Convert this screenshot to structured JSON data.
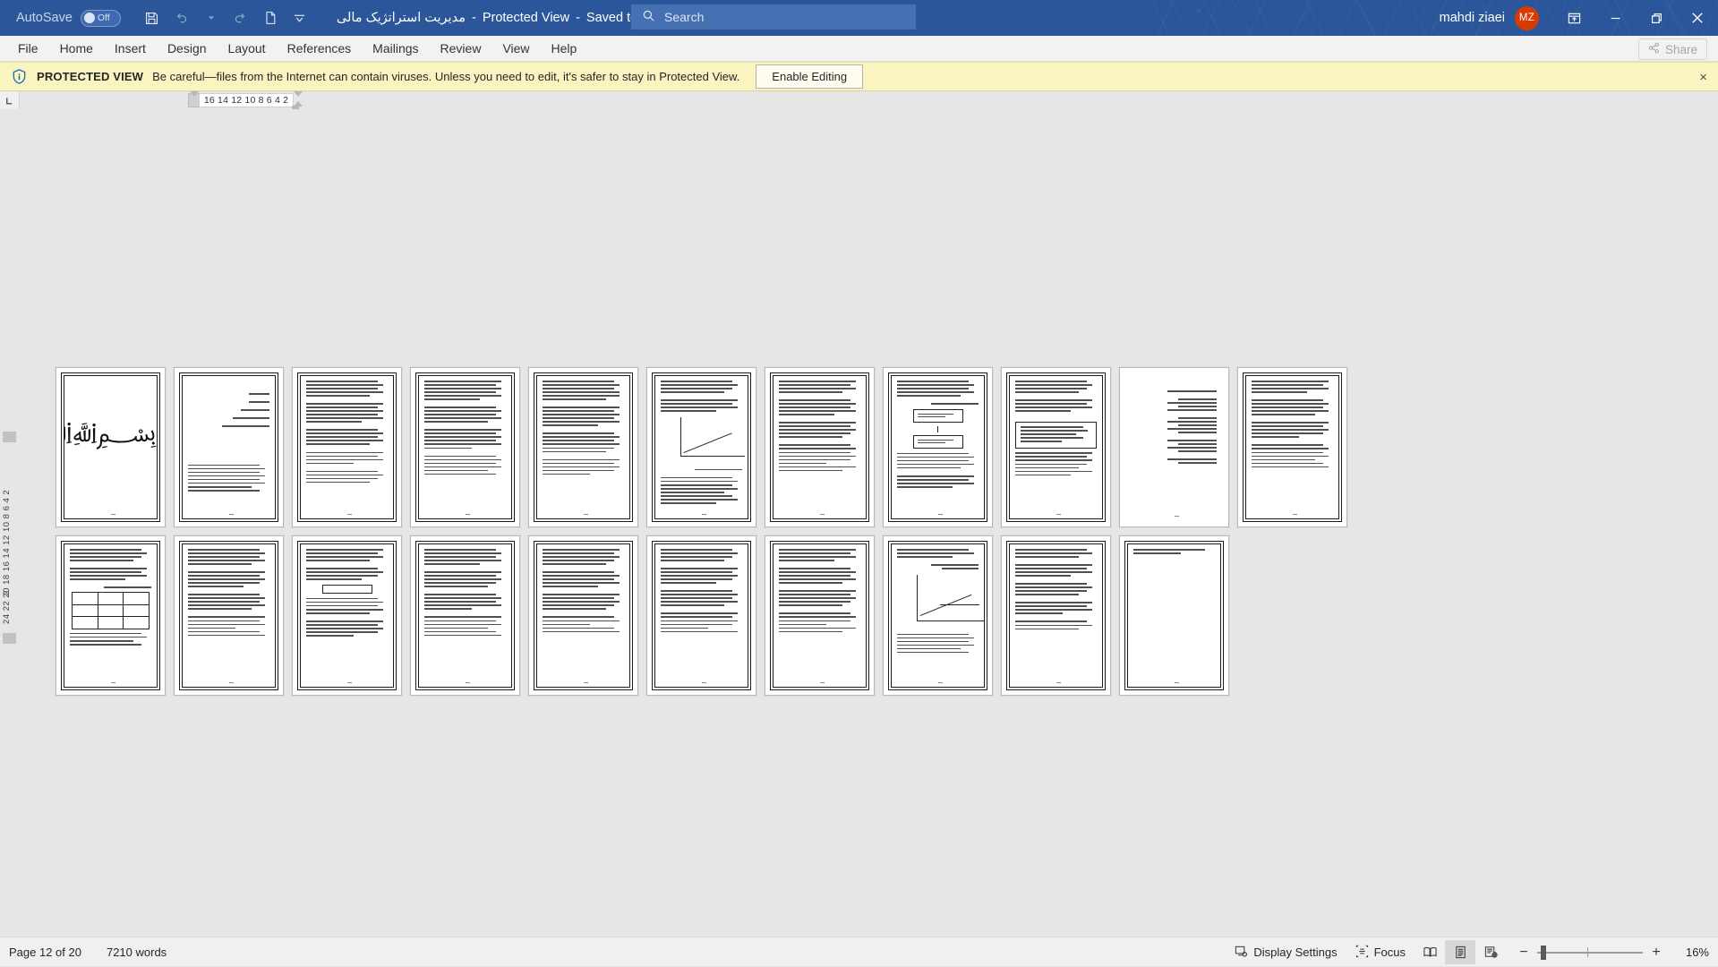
{
  "titlebar": {
    "autosave_label": "AutoSave",
    "autosave_state": "Off",
    "quick_access": [
      {
        "name": "save-icon",
        "label": "Save"
      },
      {
        "name": "undo-icon",
        "label": "Undo"
      },
      {
        "name": "redo-icon",
        "label": "Redo"
      },
      {
        "name": "new-document-icon",
        "label": "New"
      },
      {
        "name": "customize-quick-access-icon",
        "label": "Customize Quick Access Toolbar"
      }
    ],
    "document_name": "مدیریت استراتژیک مالی",
    "separator1": "-",
    "protected_view_label": "Protected View",
    "separator2": "-",
    "save_location": "Saved to this PC",
    "search_placeholder": "Search",
    "search_icon": "search-icon",
    "user_name": "mahdi ziaei",
    "user_initials": "MZ",
    "window_buttons": [
      {
        "name": "ribbon-display-options-icon",
        "label": "Ribbon Display Options"
      },
      {
        "name": "minimize-icon",
        "label": "Minimize"
      },
      {
        "name": "restore-icon",
        "label": "Restore Down"
      },
      {
        "name": "close-icon",
        "label": "Close"
      }
    ],
    "accent_color": "#2b579a",
    "avatar_color": "#d83b01"
  },
  "ribbon": {
    "tabs": [
      {
        "label": "File"
      },
      {
        "label": "Home"
      },
      {
        "label": "Insert"
      },
      {
        "label": "Design"
      },
      {
        "label": "Layout"
      },
      {
        "label": "References"
      },
      {
        "label": "Mailings"
      },
      {
        "label": "Review"
      },
      {
        "label": "View"
      },
      {
        "label": "Help"
      }
    ],
    "share_label": "Share",
    "share_icon": "share-icon"
  },
  "protected_view": {
    "icon": "shield-info-icon",
    "title": "PROTECTED VIEW",
    "message": "Be careful—files from the Internet can contain viruses. Unless you need to edit, it's safer to stay in Protected View.",
    "button_label": "Enable Editing",
    "close_label": "×",
    "background_color": "#faf4c0"
  },
  "rulers": {
    "corner_icon": "tab-stop-left-icon",
    "horizontal_marks": "16 14 12 10  8   6   4   2",
    "vertical_marks": "24 22 20 18 16 14 12 10  8   6   4   2",
    "vertical_top_mark": "2"
  },
  "document": {
    "page_count": 20,
    "zoom_percent": 16,
    "pages": [
      {
        "index": 1,
        "type": "cover-calligraphy",
        "glyph": "﷽"
      },
      {
        "index": 2,
        "type": "title-page"
      },
      {
        "index": 3,
        "type": "text"
      },
      {
        "index": 4,
        "type": "text"
      },
      {
        "index": 5,
        "type": "text"
      },
      {
        "index": 6,
        "type": "text-chart"
      },
      {
        "index": 7,
        "type": "text"
      },
      {
        "index": 8,
        "type": "text-diagram"
      },
      {
        "index": 9,
        "type": "list-page"
      },
      {
        "index": 10,
        "type": "text"
      },
      {
        "index": 11,
        "type": "text-table"
      },
      {
        "index": 12,
        "type": "text"
      },
      {
        "index": 13,
        "type": "text-diagram-small"
      },
      {
        "index": 14,
        "type": "text"
      },
      {
        "index": 15,
        "type": "text"
      },
      {
        "index": 16,
        "type": "text"
      },
      {
        "index": 17,
        "type": "text"
      },
      {
        "index": 18,
        "type": "text-chart"
      },
      {
        "index": 19,
        "type": "text"
      },
      {
        "index": 20,
        "type": "blank"
      }
    ]
  },
  "statusbar": {
    "page_status": "Page 12 of 20",
    "word_count": "7210 words",
    "display_settings_label": "Display Settings",
    "display_settings_icon": "display-settings-icon",
    "focus_label": "Focus",
    "focus_icon": "focus-icon",
    "view_buttons": [
      {
        "name": "read-mode-icon",
        "label": "Read Mode",
        "active": false
      },
      {
        "name": "print-layout-icon",
        "label": "Print Layout",
        "active": true
      },
      {
        "name": "web-layout-icon",
        "label": "Web Layout",
        "active": false
      }
    ],
    "zoom_out_label": "−",
    "zoom_in_label": "+",
    "zoom_label": "16%"
  }
}
